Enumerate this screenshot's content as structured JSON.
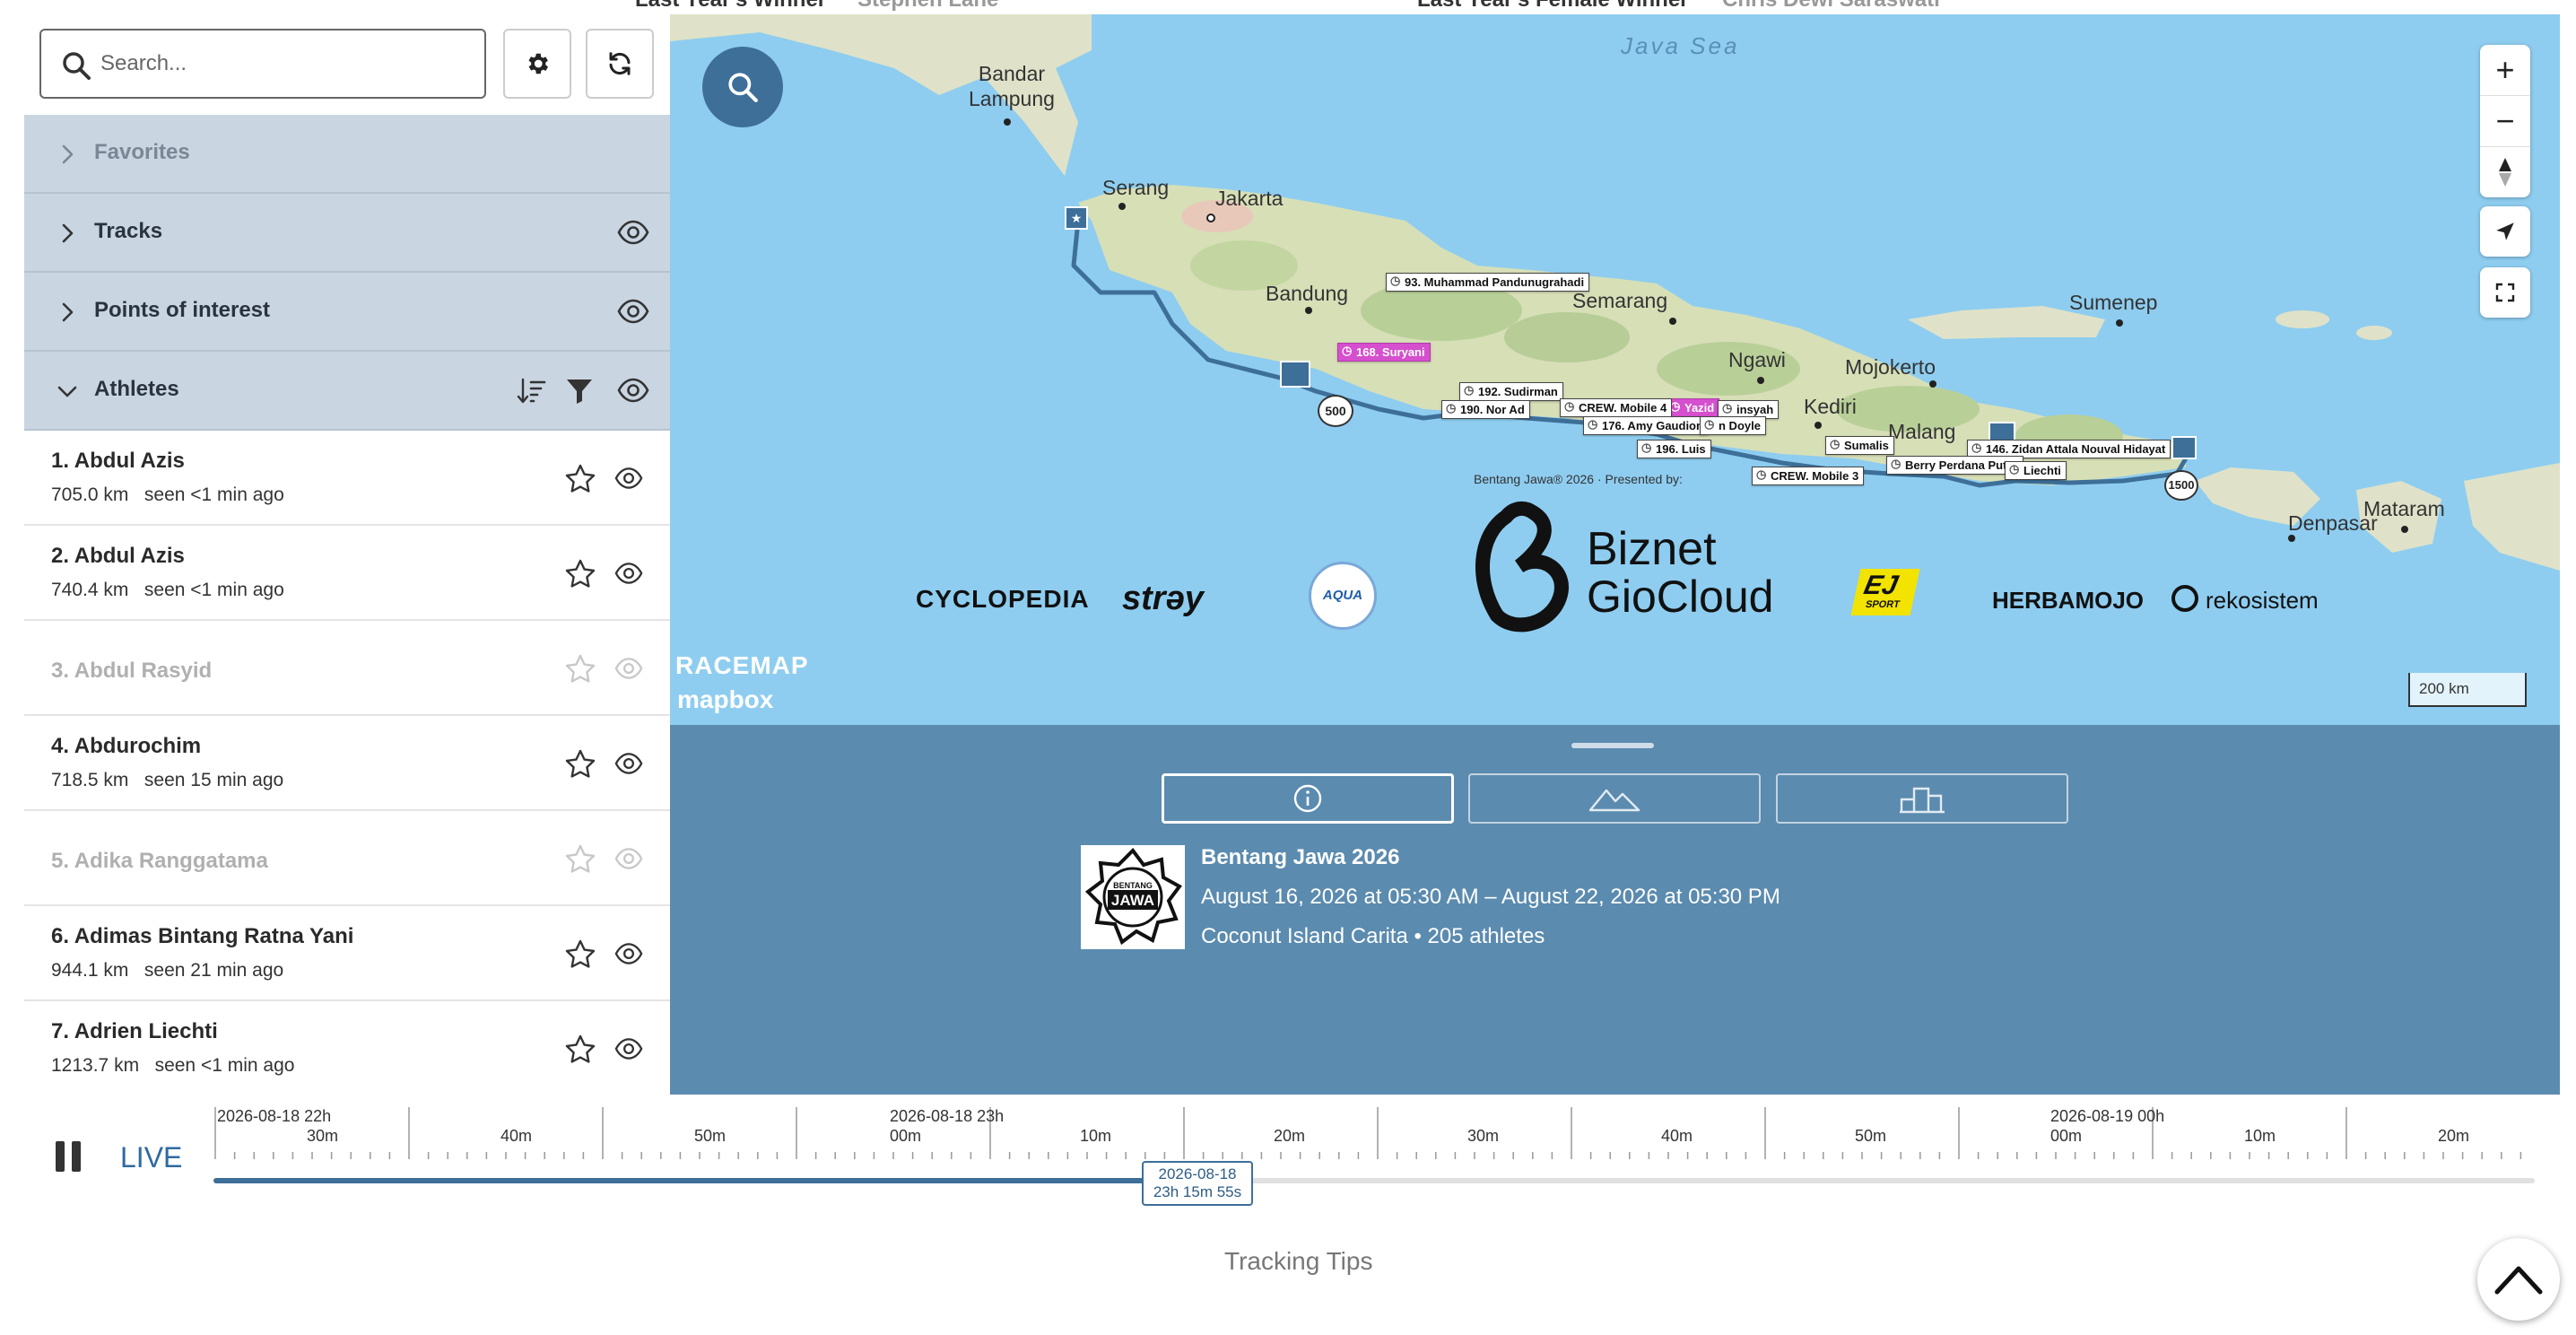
{
  "top_banner": {
    "left_label": "Last Year's Winner",
    "left_name": "Stephen Lane",
    "right_label": "Last Year's Female Winner",
    "right_name": "Chris Dewi Saraswati"
  },
  "search": {
    "placeholder": "Search..."
  },
  "toolbar": {
    "settings_icon": "gear-icon",
    "refresh_icon": "refresh-icon"
  },
  "sections": {
    "favorites": {
      "label": "Favorites"
    },
    "tracks": {
      "label": "Tracks"
    },
    "poi": {
      "label": "Points of interest"
    },
    "athletes": {
      "label": "Athletes"
    }
  },
  "athletes": [
    {
      "name": "1. Abdul Azis",
      "distance": "705.0 km",
      "seen": "seen <1 min ago",
      "active": true
    },
    {
      "name": "2. Abdul Azis",
      "distance": "740.4 km",
      "seen": "seen <1 min ago",
      "active": true
    },
    {
      "name": "3. Abdul Rasyid",
      "distance": "",
      "seen": "",
      "active": false
    },
    {
      "name": "4. Abdurochim",
      "distance": "718.5 km",
      "seen": "seen 15 min ago",
      "active": true
    },
    {
      "name": "5. Adika Ranggatama",
      "distance": "",
      "seen": "",
      "active": false
    },
    {
      "name": "6. Adimas Bintang Ratna Yani",
      "distance": "944.1 km",
      "seen": "seen 21 min ago",
      "active": true
    },
    {
      "name": "7. Adrien Liechti",
      "distance": "1213.7 km",
      "seen": "seen <1 min ago",
      "active": true
    }
  ],
  "map": {
    "sea_label": "Java Sea",
    "cities": {
      "bandar_lampung": "Bandar\nLampung",
      "serang": "Serang",
      "jakarta": "Jakarta",
      "bandung": "Bandung",
      "semarang": "Semarang",
      "sumenep": "Sumenep",
      "ngawi": "Ngawi",
      "mojokerto": "Mojokerto",
      "kediri": "Kediri",
      "malang": "Malang",
      "denpasar": "Denpasar",
      "mataram": "Mataram"
    },
    "road_badges": {
      "b500": "500",
      "b1500": "1500"
    },
    "tags": {
      "t1": "93. Muhammad Pandunugrahadi",
      "t2": "168. Suryani",
      "t3": "192. Sudirman",
      "t4": "190. Nor Ad",
      "t5": "CREW. Mobile 4",
      "t6": "176. Amy Gaudion",
      "t7": "196. Luis",
      "t8": "CREW. Mobile 3",
      "t9": "146. Zidan Attala Nouval Hidayat",
      "t10": "Berry Perdana Putra",
      "t11": "Sumalis",
      "t12": "Yazid",
      "t13": "n Doyle",
      "t14": "insyah",
      "t15": "Liechti"
    },
    "sponsor_heading": "Bentang Jawa® 2026 · Presented by:",
    "sponsors": {
      "cyclopedia": "CYCLOPEDIA",
      "stray": "strəy",
      "aqua": "AQUA",
      "biznet": "Biznet",
      "giocloud": "GioCloud",
      "ej": "EJ",
      "ej_sub": "SPORT",
      "herbamojo": "HERBAMOJO",
      "rekosistem": "rekosistem"
    },
    "racemap_label": "RACEMAP",
    "mapbox_label": "mapbox",
    "scale": "200 km",
    "zoom_in": "+",
    "zoom_out": "−"
  },
  "event": {
    "title": "Bentang Jawa 2026",
    "dates": "August 16, 2026 at 05:30 AM – August 22, 2026 at 05:30 PM",
    "location": "Coconut Island Carita • 205 athletes",
    "logo_line1": "BENTANG",
    "logo_line2": "JAWA"
  },
  "info_tabs": [
    "info-icon",
    "elevation-icon",
    "podium-icon"
  ],
  "timeline": {
    "live_label": "LIVE",
    "day_marks": [
      {
        "date": "2026-08-18 22h",
        "sub": "30m"
      },
      {
        "date": "2026-08-18 23h",
        "sub": "00m"
      },
      {
        "date": "2026-08-19 00h",
        "sub": "00m"
      }
    ],
    "minute_labels": [
      "40m",
      "50m",
      "10m",
      "20m",
      "30m",
      "40m",
      "50m",
      "10m",
      "20m"
    ],
    "cursor_date": "2026-08-18",
    "cursor_time": "23h 15m 55s",
    "progress": 0.424
  },
  "footer": {
    "tips": "Tracking Tips"
  },
  "colors": {
    "accent": "#3d6f99",
    "section_bg": "#c9d5e1",
    "panel_bg": "#5b8baf",
    "sea": "#8ecdf0",
    "athlete_tag_pink": "#d54fce"
  }
}
